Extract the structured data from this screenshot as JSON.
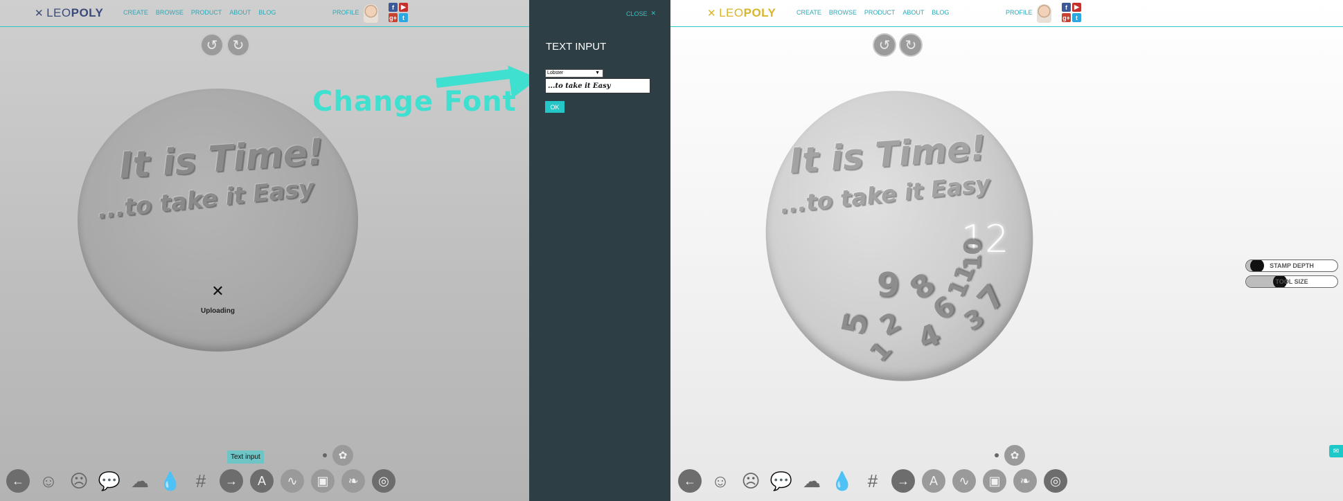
{
  "app": {
    "brand_leo": "LEO",
    "brand_poly": "POLY"
  },
  "nav": {
    "create": "CREATE",
    "browse": "BROWSE",
    "product": "PRODUCT",
    "about": "ABOUT",
    "blog": "BLOG",
    "profile": "PROFILE"
  },
  "social": {
    "facebook": "f",
    "youtube": "▶",
    "googleplus": "g+",
    "twitter": "t"
  },
  "stamp": {
    "line1": "It is Time!",
    "line2": "...to take it Easy"
  },
  "upload": {
    "label": "Uploading"
  },
  "annotation": {
    "text": "Change Font"
  },
  "panel": {
    "close_label": "CLOSE",
    "title": "TEXT INPUT",
    "font_value": "Lobster",
    "text_value": "...to take it Easy",
    "ok_label": "OK"
  },
  "toolbar": {
    "tooltip": "Text input",
    "icons": [
      "back-arrow-icon",
      "happy-face-icon",
      "sad-face-icon",
      "speech-bubble-icon",
      "cloud-icon",
      "drop-icon",
      "grid-icon",
      "forward-arrow-icon",
      "text-icon",
      "squiggle-icon",
      "image-icon",
      "leaf-icon",
      "target-icon",
      "palette-icon"
    ]
  },
  "clock": {
    "numbers": [
      "12",
      "9",
      "8",
      "11",
      "10",
      "7",
      "5",
      "2",
      "6",
      "4",
      "3",
      "1"
    ]
  },
  "sliders": {
    "stamp_depth": {
      "label": "STAMP DEPTH",
      "value": 0.05
    },
    "tool_size": {
      "label": "TOOL SIZE",
      "value": 0.35
    }
  },
  "colors": {
    "accent": "#2ec4c4",
    "panel_bg": "#2e3e45",
    "annotation": "#40e0d0",
    "logo_left": "#3a4b7a",
    "logo_right": "#d8b52c"
  }
}
